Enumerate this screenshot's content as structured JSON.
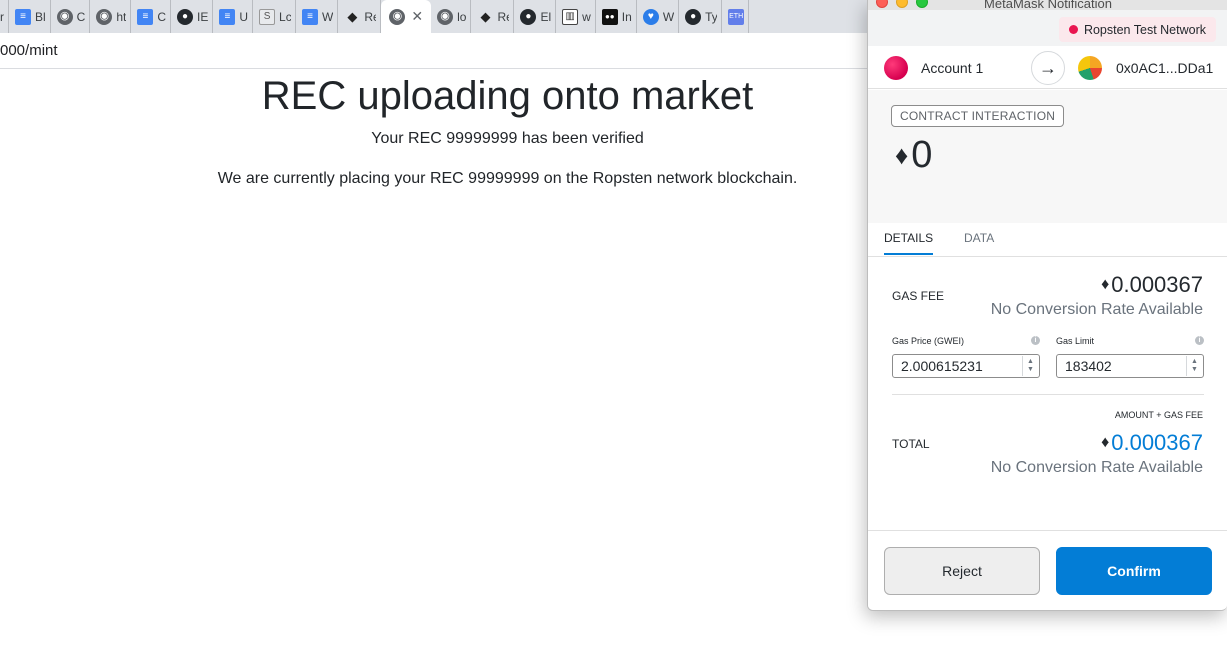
{
  "browser": {
    "tabs": [
      {
        "icon": "globe-icon",
        "glyph": "",
        "label": "r"
      },
      {
        "icon": "doc-icon",
        "glyph": "≡",
        "label": "Bl"
      },
      {
        "icon": "globe-icon",
        "glyph": "◉",
        "label": "C"
      },
      {
        "icon": "globe-icon",
        "glyph": "◉",
        "label": "ht"
      },
      {
        "icon": "doc-icon",
        "glyph": "≡",
        "label": "C"
      },
      {
        "icon": "github-icon",
        "glyph": "●",
        "label": "IE"
      },
      {
        "icon": "doc-icon",
        "glyph": "≡",
        "label": "U"
      },
      {
        "icon": "s-icon",
        "glyph": "S",
        "label": "Lc"
      },
      {
        "icon": "doc-icon",
        "glyph": "≡",
        "label": "W"
      },
      {
        "icon": "metamask-icon",
        "glyph": "◆",
        "label": "Re"
      },
      {
        "icon": "globe-icon",
        "glyph": "◉",
        "label": "",
        "active": true
      },
      {
        "icon": "globe-icon",
        "glyph": "◉",
        "label": "lo"
      },
      {
        "icon": "metamask-icon",
        "glyph": "◆",
        "label": "Re"
      },
      {
        "icon": "github-icon",
        "glyph": "●",
        "label": "El"
      },
      {
        "icon": "book-icon",
        "glyph": "▥",
        "label": "w"
      },
      {
        "icon": "media-icon",
        "glyph": "●●",
        "label": "In"
      },
      {
        "icon": "heart-icon",
        "glyph": "♥",
        "label": "W"
      },
      {
        "icon": "github-icon",
        "glyph": "●",
        "label": "Ty"
      },
      {
        "icon": "eth-icon",
        "glyph": "ETH",
        "label": ""
      }
    ],
    "url": "000/mint"
  },
  "page": {
    "title": "REC uploading onto market",
    "line1": "Your REC 99999999 has been verified",
    "line2": "We are currently placing your REC 99999999 on the Ropsten network blockchain."
  },
  "metamask": {
    "window_title": "MetaMask Notification",
    "network": "Ropsten Test Network",
    "from_account": "Account 1",
    "to_address": "0x0AC1...DDa1",
    "badge": "CONTRACT INTERACTION",
    "amount": "0",
    "tabs": {
      "details": "DETAILS",
      "data": "DATA"
    },
    "gas_fee_label": "GAS FEE",
    "gas_fee_value": "0.000367",
    "gas_fee_conversion": "No Conversion Rate Available",
    "gas_price_label": "Gas Price (GWEI)",
    "gas_price_value": "2.000615231",
    "gas_limit_label": "Gas Limit",
    "gas_limit_value": "183402",
    "amount_gas_fee_label": "AMOUNT + GAS FEE",
    "total_label": "TOTAL",
    "total_value": "0.000367",
    "total_conversion": "No Conversion Rate Available",
    "reject_label": "Reject",
    "confirm_label": "Confirm",
    "colors": {
      "accent": "#037dd6",
      "network_dot": "#e91550",
      "network_bg": "#fbe8ec"
    }
  }
}
